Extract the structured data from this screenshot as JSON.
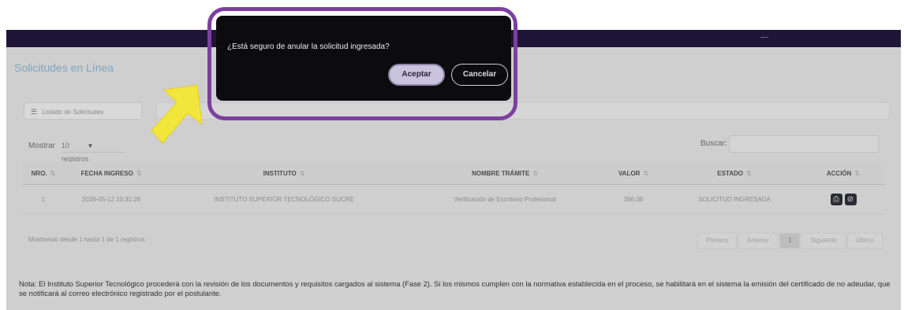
{
  "page": {
    "title": "Solicitudes en Línea",
    "topbar_right": "—",
    "filter_icon": "list-icon",
    "filter_label": "Listado de Solicitudes"
  },
  "table_controls": {
    "show_label": "Mostrar",
    "page_size": "10",
    "records_label": "registros",
    "search_label": "Buscar:",
    "search_value": ""
  },
  "table": {
    "headers": [
      "NRO.",
      "FECHA INGRESO",
      "INSTITUTO",
      "NOMBRE TRÁMITE",
      "VALOR",
      "ESTADO",
      "ACCIÓN"
    ],
    "rows": [
      {
        "nro": "1",
        "fecha": "2026-05-12 10:31:26",
        "instituto": "INSTITUTO SUPERIOR TECNOLÓGICO SUCRE",
        "tramite": "Verificación de Escritorio Profesional",
        "valor": "398.08",
        "estado": "SOLICITUD INGRESADA",
        "actions": [
          "printer-icon",
          "cancel-circle-icon"
        ]
      }
    ]
  },
  "footer": {
    "info": "Mostrando desde 1 hasta 1 de 1 registros",
    "pager": [
      "Primero",
      "Anterior",
      "1",
      "Siguiente",
      "Último"
    ],
    "current_page": "1"
  },
  "note": "Nota: El Instituto Superior Tecnológico procederá con la revisión de los documentos y requisitos cargados al sistema (Fase 2). Si los mismos cumplen con la normativa establecida en el proceso, se habilitará en el sistema la emisión del certificado de no adeudar, que se notificará al correo electrónico registrado por el postulante.",
  "dialog": {
    "message": "¿Está seguro de anular la solicitud ingresada?",
    "accept_label": "Aceptar",
    "cancel_label": "Cancelar"
  },
  "annotation": {
    "highlight_color": "#7d3fa0",
    "arrow_color": "#f3e63a"
  }
}
